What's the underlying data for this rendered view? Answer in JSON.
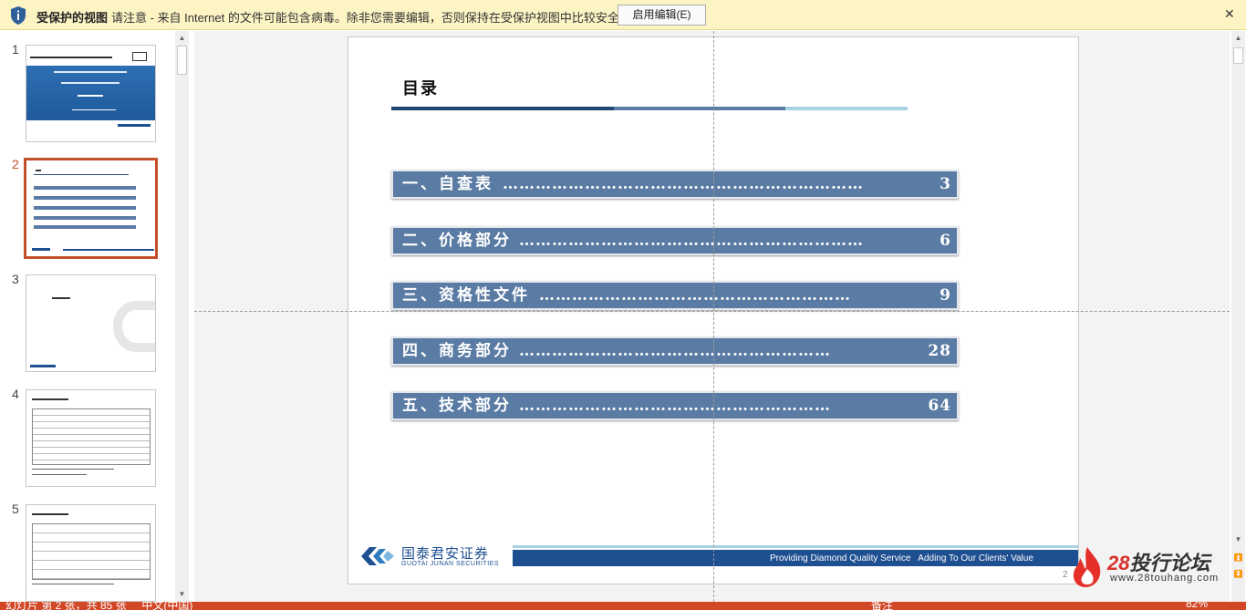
{
  "protected_view": {
    "title": "受保护的视图",
    "message": "请注意 - 来自 Internet 的文件可能包含病毒。除非您需要编辑，否则保持在受保护视图中比较安全。",
    "enable_button": "启用编辑(E)",
    "close_glyph": "✕",
    "icon": "shield-info-icon"
  },
  "thumbnails": [
    {
      "num": "1",
      "active": false
    },
    {
      "num": "2",
      "active": true
    },
    {
      "num": "3",
      "active": false
    },
    {
      "num": "4",
      "active": false
    },
    {
      "num": "5",
      "active": false
    }
  ],
  "slide": {
    "title": "目录",
    "toc": [
      {
        "label": "一、自查表",
        "dots": "…………………………………………………………",
        "page": "3"
      },
      {
        "label": "二、价格部分",
        "dots": "………………………………………………………",
        "page": "6"
      },
      {
        "label": "三、资格性文件",
        "dots": "…………………………………………………",
        "page": "9"
      },
      {
        "label": "四、商务部分",
        "dots": "…………………………………………………",
        "page": "28"
      },
      {
        "label": "五、技术部分",
        "dots": "…………………………………………………",
        "page": "64"
      }
    ],
    "footer_text": "Providing Diamond Quality Service   Adding To Our Clients' Value",
    "logo_cn": "国泰君安证券",
    "logo_en": "GUOTAI JUNAN SECURITIES",
    "page_number": "2"
  },
  "watermark": {
    "num": "28",
    "name": "投行论坛",
    "url": "www.28touhang.com"
  },
  "status_bar": {
    "left": "幻灯片 第 2 张，共 85 张     中文(中国)",
    "notes": "备注",
    "zoom": "82%"
  },
  "colors": {
    "toc_fill": "#5a7ba3",
    "accent": "#c4502a",
    "brand_blue": "#1d4f91",
    "status_bar": "#d24726",
    "pv_bar": "#fdf4c4"
  }
}
